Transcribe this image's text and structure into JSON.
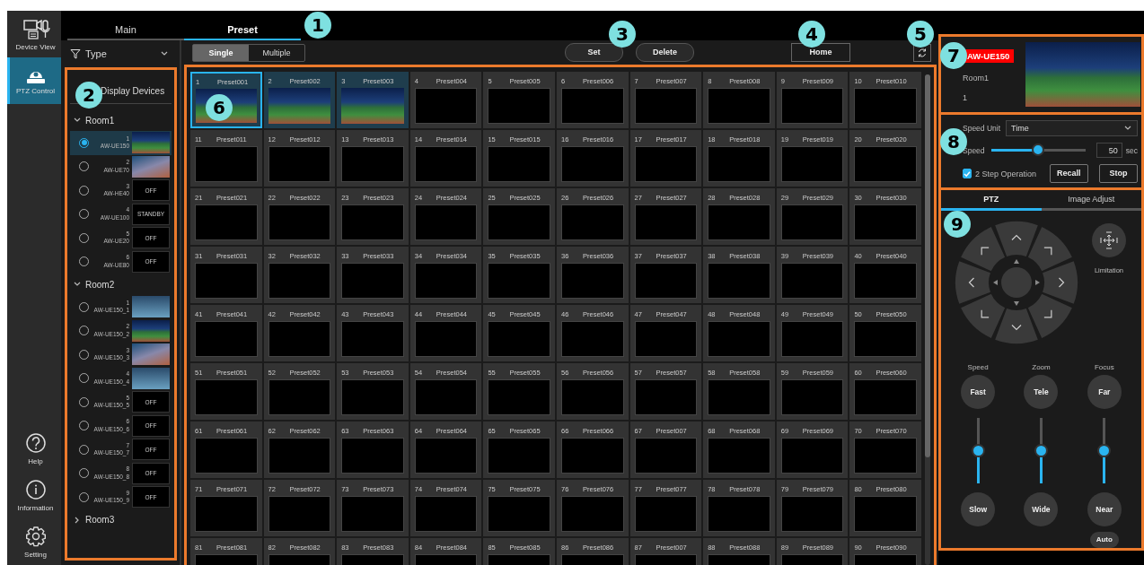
{
  "nav": {
    "top": [
      {
        "kind": "device_view",
        "label": "Device View",
        "selected": false
      },
      {
        "kind": "ptz",
        "label": "PTZ Control",
        "selected": true
      }
    ],
    "bottom": [
      {
        "kind": "help",
        "label": "Help",
        "selected": false
      },
      {
        "kind": "info",
        "label": "Information",
        "selected": false
      },
      {
        "kind": "settings",
        "label": "Setting",
        "selected": false
      }
    ]
  },
  "tabs": [
    {
      "label": "Main",
      "selected": false
    },
    {
      "label": "Preset",
      "selected": true
    }
  ],
  "filter": {
    "label": "Type"
  },
  "devices": {
    "title": "Display Devices",
    "rooms": [
      {
        "name": "Room1",
        "expanded": true,
        "children": [
          {
            "number": "1",
            "model": "AW-UE150",
            "selected": true,
            "kind": "video"
          },
          {
            "number": "2",
            "model": "AW-UE70",
            "selected": false,
            "kind": "video"
          },
          {
            "number": "3",
            "model": "AW-HE40",
            "selected": false,
            "kind": "status",
            "status": "OFF"
          },
          {
            "number": "4",
            "model": "AW-UE100",
            "selected": false,
            "kind": "status",
            "status": "STANDBY"
          },
          {
            "number": "5",
            "model": "AW-UE20",
            "selected": false,
            "kind": "status",
            "status": "OFF"
          },
          {
            "number": "6",
            "model": "AW-UE80",
            "selected": false,
            "kind": "status",
            "status": "OFF"
          }
        ]
      },
      {
        "name": "Room2",
        "expanded": true,
        "children": [
          {
            "number": "1",
            "model": "AW-UE150_1",
            "selected": false,
            "kind": "video"
          },
          {
            "number": "2",
            "model": "AW-UE150_2",
            "selected": false,
            "kind": "video"
          },
          {
            "number": "3",
            "model": "AW-UE150_3",
            "selected": false,
            "kind": "video"
          },
          {
            "number": "4",
            "model": "AW-UE150_4",
            "selected": false,
            "kind": "video"
          },
          {
            "number": "5",
            "model": "AW-UE150_5",
            "selected": false,
            "kind": "status",
            "status": "OFF"
          },
          {
            "number": "6",
            "model": "AW-UE150_6",
            "selected": false,
            "kind": "status",
            "status": "OFF"
          },
          {
            "number": "7",
            "model": "AW-UE150_7",
            "selected": false,
            "kind": "status",
            "status": "OFF"
          },
          {
            "number": "8",
            "model": "AW-UE150_8",
            "selected": false,
            "kind": "status",
            "status": "OFF"
          },
          {
            "number": "9",
            "model": "AW-UE150_9",
            "selected": false,
            "kind": "status",
            "status": "OFF"
          }
        ]
      },
      {
        "name": "Room3",
        "expanded": false
      }
    ]
  },
  "toolbar": {
    "modes": [
      {
        "label": "Single",
        "selected": true
      },
      {
        "label": "Multiple",
        "selected": false
      }
    ],
    "actions": [
      "Set",
      "Delete"
    ],
    "home": "Home"
  },
  "presets": [
    {
      "number": "1",
      "name": "Preset001",
      "selected": true,
      "thumbnail": true
    },
    {
      "number": "2",
      "name": "Preset002",
      "selected": false,
      "thumbnail": true
    },
    {
      "number": "3",
      "name": "Preset003",
      "selected": false,
      "thumbnail": true
    },
    {
      "number": "4",
      "name": "Preset004",
      "selected": false,
      "thumbnail": false
    },
    {
      "number": "5",
      "name": "Preset005",
      "selected": false,
      "thumbnail": false
    },
    {
      "number": "6",
      "name": "Preset006",
      "selected": false,
      "thumbnail": false
    },
    {
      "number": "7",
      "name": "Preset007",
      "selected": false,
      "thumbnail": false
    },
    {
      "number": "8",
      "name": "Preset008",
      "selected": false,
      "thumbnail": false
    },
    {
      "number": "9",
      "name": "Preset009",
      "selected": false,
      "thumbnail": false
    },
    {
      "number": "10",
      "name": "Preset010",
      "selected": false,
      "thumbnail": false
    },
    {
      "number": "11",
      "name": "Preset011",
      "selected": false,
      "thumbnail": false
    },
    {
      "number": "12",
      "name": "Preset012",
      "selected": false,
      "thumbnail": false
    },
    {
      "number": "13",
      "name": "Preset013",
      "selected": false,
      "thumbnail": false
    },
    {
      "number": "14",
      "name": "Preset014",
      "selected": false,
      "thumbnail": false
    },
    {
      "number": "15",
      "name": "Preset015",
      "selected": false,
      "thumbnail": false
    },
    {
      "number": "16",
      "name": "Preset016",
      "selected": false,
      "thumbnail": false
    },
    {
      "number": "17",
      "name": "Preset017",
      "selected": false,
      "thumbnail": false
    },
    {
      "number": "18",
      "name": "Preset018",
      "selected": false,
      "thumbnail": false
    },
    {
      "number": "19",
      "name": "Preset019",
      "selected": false,
      "thumbnail": false
    },
    {
      "number": "20",
      "name": "Preset020",
      "selected": false,
      "thumbnail": false
    },
    {
      "number": "21",
      "name": "Preset021",
      "selected": false,
      "thumbnail": false
    },
    {
      "number": "22",
      "name": "Preset022",
      "selected": false,
      "thumbnail": false
    },
    {
      "number": "23",
      "name": "Preset023",
      "selected": false,
      "thumbnail": false
    },
    {
      "number": "24",
      "name": "Preset024",
      "selected": false,
      "thumbnail": false
    },
    {
      "number": "25",
      "name": "Preset025",
      "selected": false,
      "thumbnail": false
    },
    {
      "number": "26",
      "name": "Preset026",
      "selected": false,
      "thumbnail": false
    },
    {
      "number": "27",
      "name": "Preset027",
      "selected": false,
      "thumbnail": false
    },
    {
      "number": "28",
      "name": "Preset028",
      "selected": false,
      "thumbnail": false
    },
    {
      "number": "29",
      "name": "Preset029",
      "selected": false,
      "thumbnail": false
    },
    {
      "number": "30",
      "name": "Preset030",
      "selected": false,
      "thumbnail": false
    },
    {
      "number": "31",
      "name": "Preset031",
      "selected": false,
      "thumbnail": false
    },
    {
      "number": "32",
      "name": "Preset032",
      "selected": false,
      "thumbnail": false
    },
    {
      "number": "33",
      "name": "Preset033",
      "selected": false,
      "thumbnail": false
    },
    {
      "number": "34",
      "name": "Preset034",
      "selected": false,
      "thumbnail": false
    },
    {
      "number": "35",
      "name": "Preset035",
      "selected": false,
      "thumbnail": false
    },
    {
      "number": "36",
      "name": "Preset036",
      "selected": false,
      "thumbnail": false
    },
    {
      "number": "37",
      "name": "Preset037",
      "selected": false,
      "thumbnail": false
    },
    {
      "number": "38",
      "name": "Preset038",
      "selected": false,
      "thumbnail": false
    },
    {
      "number": "39",
      "name": "Preset039",
      "selected": false,
      "thumbnail": false
    },
    {
      "number": "40",
      "name": "Preset040",
      "selected": false,
      "thumbnail": false
    },
    {
      "number": "41",
      "name": "Preset041",
      "selected": false,
      "thumbnail": false
    },
    {
      "number": "42",
      "name": "Preset042",
      "selected": false,
      "thumbnail": false
    },
    {
      "number": "43",
      "name": "Preset043",
      "selected": false,
      "thumbnail": false
    },
    {
      "number": "44",
      "name": "Preset044",
      "selected": false,
      "thumbnail": false
    },
    {
      "number": "45",
      "name": "Preset045",
      "selected": false,
      "thumbnail": false
    },
    {
      "number": "46",
      "name": "Preset046",
      "selected": false,
      "thumbnail": false
    },
    {
      "number": "47",
      "name": "Preset047",
      "selected": false,
      "thumbnail": false
    },
    {
      "number": "48",
      "name": "Preset048",
      "selected": false,
      "thumbnail": false
    },
    {
      "number": "49",
      "name": "Preset049",
      "selected": false,
      "thumbnail": false
    },
    {
      "number": "50",
      "name": "Preset050",
      "selected": false,
      "thumbnail": false
    },
    {
      "number": "51",
      "name": "Preset051",
      "selected": false,
      "thumbnail": false
    },
    {
      "number": "52",
      "name": "Preset052",
      "selected": false,
      "thumbnail": false
    },
    {
      "number": "53",
      "name": "Preset053",
      "selected": false,
      "thumbnail": false
    },
    {
      "number": "54",
      "name": "Preset054",
      "selected": false,
      "thumbnail": false
    },
    {
      "number": "55",
      "name": "Preset055",
      "selected": false,
      "thumbnail": false
    },
    {
      "number": "56",
      "name": "Preset056",
      "selected": false,
      "thumbnail": false
    },
    {
      "number": "57",
      "name": "Preset057",
      "selected": false,
      "thumbnail": false
    },
    {
      "number": "58",
      "name": "Preset058",
      "selected": false,
      "thumbnail": false
    },
    {
      "number": "59",
      "name": "Preset059",
      "selected": false,
      "thumbnail": false
    },
    {
      "number": "60",
      "name": "Preset060",
      "selected": false,
      "thumbnail": false
    },
    {
      "number": "61",
      "name": "Preset061",
      "selected": false,
      "thumbnail": false
    },
    {
      "number": "62",
      "name": "Preset062",
      "selected": false,
      "thumbnail": false
    },
    {
      "number": "63",
      "name": "Preset063",
      "selected": false,
      "thumbnail": false
    },
    {
      "number": "64",
      "name": "Preset064",
      "selected": false,
      "thumbnail": false
    },
    {
      "number": "65",
      "name": "Preset065",
      "selected": false,
      "thumbnail": false
    },
    {
      "number": "66",
      "name": "Preset066",
      "selected": false,
      "thumbnail": false
    },
    {
      "number": "67",
      "name": "Preset007",
      "selected": false,
      "thumbnail": false
    },
    {
      "number": "68",
      "name": "Preset068",
      "selected": false,
      "thumbnail": false
    },
    {
      "number": "69",
      "name": "Preset069",
      "selected": false,
      "thumbnail": false
    },
    {
      "number": "70",
      "name": "Preset070",
      "selected": false,
      "thumbnail": false
    },
    {
      "number": "71",
      "name": "Preset071",
      "selected": false,
      "thumbnail": false
    },
    {
      "number": "72",
      "name": "Preset072",
      "selected": false,
      "thumbnail": false
    },
    {
      "number": "73",
      "name": "Preset073",
      "selected": false,
      "thumbnail": false
    },
    {
      "number": "74",
      "name": "Preset074",
      "selected": false,
      "thumbnail": false
    },
    {
      "number": "75",
      "name": "Preset075",
      "selected": false,
      "thumbnail": false
    },
    {
      "number": "76",
      "name": "Preset076",
      "selected": false,
      "thumbnail": false
    },
    {
      "number": "77",
      "name": "Preset077",
      "selected": false,
      "thumbnail": false
    },
    {
      "number": "78",
      "name": "Preset078",
      "selected": false,
      "thumbnail": false
    },
    {
      "number": "79",
      "name": "Preset079",
      "selected": false,
      "thumbnail": false
    },
    {
      "number": "80",
      "name": "Preset080",
      "selected": false,
      "thumbnail": false
    },
    {
      "number": "81",
      "name": "Preset081",
      "selected": false,
      "thumbnail": false
    },
    {
      "number": "82",
      "name": "Preset082",
      "selected": false,
      "thumbnail": false
    },
    {
      "number": "83",
      "name": "Preset083",
      "selected": false,
      "thumbnail": false
    },
    {
      "number": "84",
      "name": "Preset084",
      "selected": false,
      "thumbnail": false
    },
    {
      "number": "85",
      "name": "Preset085",
      "selected": false,
      "thumbnail": false
    },
    {
      "number": "86",
      "name": "Preset086",
      "selected": false,
      "thumbnail": false
    },
    {
      "number": "87",
      "name": "Preset007",
      "selected": false,
      "thumbnail": false
    },
    {
      "number": "88",
      "name": "Preset088",
      "selected": false,
      "thumbnail": false
    },
    {
      "number": "89",
      "name": "Preset089",
      "selected": false,
      "thumbnail": false
    },
    {
      "number": "90",
      "name": "Preset090",
      "selected": false,
      "thumbnail": false
    }
  ],
  "camera": {
    "model": "AW-UE150",
    "room": "Room1",
    "number": "1"
  },
  "settings": {
    "speed_unit": {
      "label": "Speed Unit",
      "value": "Time"
    },
    "speed": {
      "label": "Speed",
      "level": 0.5,
      "value": "50",
      "unit": "sec"
    },
    "two_step": {
      "label": "2 Step Operation",
      "checked": true
    },
    "buttons": [
      "Recall",
      "Stop"
    ]
  },
  "ptz": {
    "tabs": [
      {
        "label": "PTZ",
        "selected": true
      },
      {
        "label": "Image Adjust",
        "selected": false
      }
    ],
    "limitation": "Limitation",
    "controls": [
      {
        "title": "Speed",
        "top": "Fast",
        "bottom": "Slow",
        "level": 0.5
      },
      {
        "title": "Zoom",
        "top": "Tele",
        "bottom": "Wide",
        "level": 0.5
      },
      {
        "title": "Focus",
        "top": "Far",
        "bottom": "Near",
        "level": 0.5,
        "auto": "Auto"
      }
    ]
  },
  "callouts": [
    "1",
    "2",
    "3",
    "4",
    "5",
    "6",
    "7",
    "8",
    "9"
  ]
}
